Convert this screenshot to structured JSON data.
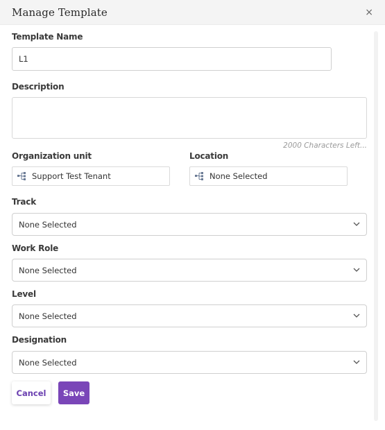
{
  "dialog": {
    "title": "Manage Template",
    "close_glyph": "×"
  },
  "form": {
    "template_name": {
      "label": "Template Name",
      "value": "L1"
    },
    "description": {
      "label": "Description",
      "value": "",
      "counter": "2000 Characters Left..."
    },
    "organization_unit": {
      "label": "Organization unit",
      "value": "Support Test Tenant",
      "icon": "tree-structure-icon"
    },
    "location": {
      "label": "Location",
      "value": "None Selected",
      "icon": "tree-structure-icon"
    },
    "track": {
      "label": "Track",
      "value": "None Selected"
    },
    "work_role": {
      "label": "Work Role",
      "value": "None Selected"
    },
    "level": {
      "label": "Level",
      "value": "None Selected"
    },
    "designation": {
      "label": "Designation",
      "value": "None Selected"
    }
  },
  "actions": {
    "cancel_label": "Cancel",
    "save_label": "Save"
  },
  "colors": {
    "accent": "#7a46b8",
    "header_bg": "#f4f4f4"
  }
}
